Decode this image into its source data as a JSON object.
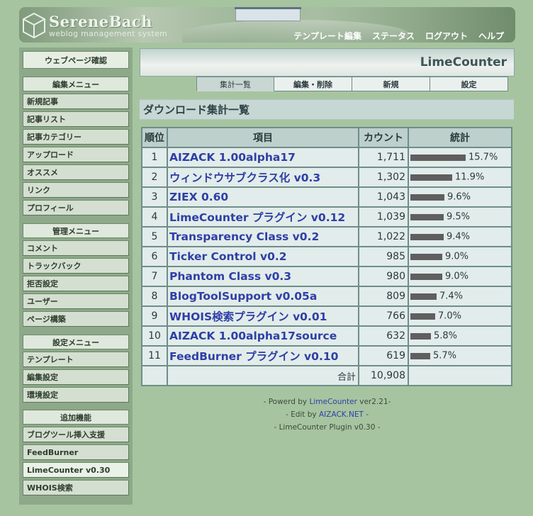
{
  "header": {
    "logo_title": "SereneBach",
    "logo_subtitle": "weblog management system",
    "nav": [
      "テンプレート編集",
      "ステータス",
      "ログアウト",
      "ヘルプ"
    ]
  },
  "sidebar": {
    "top_button": "ウェブページ確認",
    "sections": [
      {
        "heading": "編集メニュー",
        "items": [
          "新規記事",
          "記事リスト",
          "記事カテゴリー",
          "アップロード",
          "オススメ",
          "リンク",
          "プロフィール"
        ]
      },
      {
        "heading": "管理メニュー",
        "items": [
          "コメント",
          "トラックバック",
          "拒否設定",
          "ユーザー",
          "ページ構築"
        ]
      },
      {
        "heading": "設定メニュー",
        "items": [
          "テンプレート",
          "編集設定",
          "環境設定"
        ]
      },
      {
        "heading": "追加機能",
        "items": [
          "ブログツール挿入支援",
          "FeedBurner",
          "LimeCounter v0.30",
          "WHOIS検索"
        ]
      }
    ],
    "active_item": "LimeCounter v0.30"
  },
  "page": {
    "title": "LimeCounter",
    "tabs": [
      "集計一覧",
      "編集・削除",
      "新規",
      "設定"
    ],
    "active_tab": "集計一覧",
    "section_title": "ダウンロード集計一覧"
  },
  "table": {
    "headers": [
      "順位",
      "項目",
      "カウント",
      "統計"
    ],
    "rows": [
      {
        "rank": "1",
        "item": "AIZACK 1.00alpha17",
        "count": "1,711",
        "percent": "15.7%",
        "share": 15.7
      },
      {
        "rank": "2",
        "item": "ウィンドウサブクラス化 v0.3",
        "count": "1,302",
        "percent": "11.9%",
        "share": 11.9
      },
      {
        "rank": "3",
        "item": "ZIEX 0.60",
        "count": "1,043",
        "percent": "9.6%",
        "share": 9.6
      },
      {
        "rank": "4",
        "item": "LimeCounter プラグイン v0.12",
        "count": "1,039",
        "percent": "9.5%",
        "share": 9.5
      },
      {
        "rank": "5",
        "item": "Transparency Class v0.2",
        "count": "1,022",
        "percent": "9.4%",
        "share": 9.4
      },
      {
        "rank": "6",
        "item": "Ticker Control v0.2",
        "count": "985",
        "percent": "9.0%",
        "share": 9.0
      },
      {
        "rank": "7",
        "item": "Phantom Class v0.3",
        "count": "980",
        "percent": "9.0%",
        "share": 9.0
      },
      {
        "rank": "8",
        "item": "BlogToolSupport v0.05a",
        "count": "809",
        "percent": "7.4%",
        "share": 7.4
      },
      {
        "rank": "9",
        "item": "WHOIS検索プラグイン v0.01",
        "count": "766",
        "percent": "7.0%",
        "share": 7.0
      },
      {
        "rank": "10",
        "item": "AIZACK 1.00alpha17source",
        "count": "632",
        "percent": "5.8%",
        "share": 5.8
      },
      {
        "rank": "11",
        "item": "FeedBurner プラグイン v0.10",
        "count": "619",
        "percent": "5.7%",
        "share": 5.7
      }
    ],
    "total_label": "合計",
    "total_count": "10,908"
  },
  "footer": {
    "line1_prefix": "- Powerd by ",
    "line1_link": "LimeCounter",
    "line1_suffix": " ver2.21-",
    "line2_prefix": "- Edit by ",
    "line2_link": "AIZACK.NET",
    "line2_suffix": " -",
    "line3": "- LimeCounter Plugin v0.30 -"
  },
  "colors": {
    "background": "#a7c4a0",
    "link": "#2e3fa6",
    "bar": "#5f5f5f"
  }
}
